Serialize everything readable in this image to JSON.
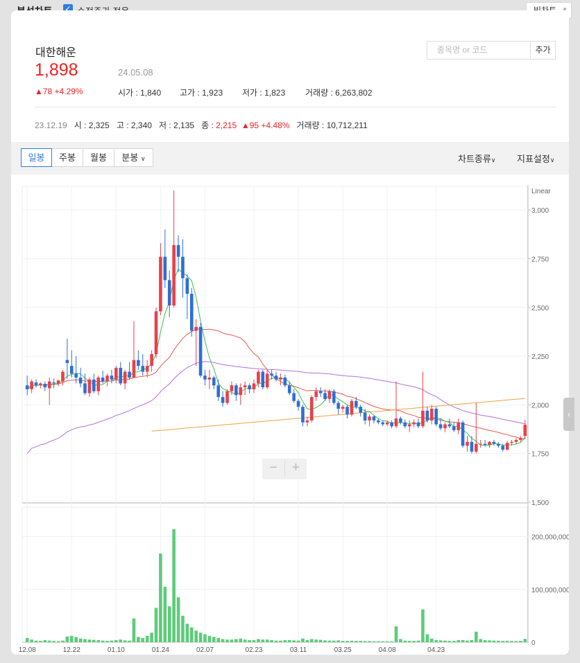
{
  "topbar": {
    "title": "분석차트",
    "checkbox_label": "수정주가 적용",
    "big_chart_label": "빅차트"
  },
  "stock": {
    "name": "대한해운",
    "price": "1,898",
    "date": "24.05.08",
    "change": "▲78 +4.29%",
    "open_label": "시가",
    "open": "1,840",
    "high_label": "고가",
    "high": "1,923",
    "low_label": "저가",
    "low": "1,823",
    "volume_label": "거래량",
    "volume": "6,263,802"
  },
  "search": {
    "placeholder": "종목명 or 코드",
    "add_label": "추가"
  },
  "reference": {
    "date": "23.12.19",
    "open_label": "시",
    "open": "2,325",
    "high_label": "고",
    "high": "2,340",
    "low_label": "저",
    "low": "2,135",
    "close_label": "종",
    "close": "2,215",
    "change": "▲95 +4.48%",
    "volume_label": "거래량",
    "volume": "10,712,211"
  },
  "toolbar": {
    "tabs": [
      "일봉",
      "주봉",
      "월봉",
      "분봉"
    ],
    "active_tab": "일봉",
    "chart_type_label": "차트종류",
    "indicator_label": "지표설정"
  },
  "chart_data": {
    "type": "candlestick",
    "scale_label": "Linear",
    "price_axis": {
      "min": 1500,
      "max": 3100,
      "ticks": [
        "3,000",
        "2,750",
        "2,500",
        "2,250",
        "2,000",
        "1,750",
        "1,500"
      ]
    },
    "volume_axis": {
      "max": 240000000,
      "ticks": [
        "200,000,000",
        "100,000,000",
        "0"
      ]
    },
    "x_ticks": [
      "12.08",
      "12.22",
      "01.10",
      "01.24",
      "02.07",
      "02.23",
      "03.11",
      "03.25",
      "04.08",
      "04.23"
    ],
    "colors": {
      "up": "#e8414a",
      "down": "#2e6fd6",
      "ma5": "#3cc04d",
      "ma20": "#e25a50",
      "ma60": "#b46ee0",
      "ma120": "#f0a040",
      "volume": "#5ecb7a"
    },
    "candles": [
      [
        2100,
        2150,
        2050,
        2080,
        8000000
      ],
      [
        2080,
        2130,
        2060,
        2120,
        5000000
      ],
      [
        2115,
        2130,
        2090,
        2100,
        3000000
      ],
      [
        2100,
        2115,
        2085,
        2110,
        2500000
      ],
      [
        2108,
        2120,
        2070,
        2090,
        4000000
      ],
      [
        2085,
        2140,
        2000,
        2120,
        3000000
      ],
      [
        2115,
        2135,
        2085,
        2110,
        2500000
      ],
      [
        2110,
        2130,
        2095,
        2125,
        2000000
      ],
      [
        2120,
        2180,
        2100,
        2170,
        3000000
      ],
      [
        2230,
        2340,
        2135,
        2215,
        10712211
      ],
      [
        2200,
        2280,
        2140,
        2160,
        12000000
      ],
      [
        2160,
        2250,
        2110,
        2140,
        10000000
      ],
      [
        2140,
        2190,
        2090,
        2110,
        7000000
      ],
      [
        2110,
        2160,
        2050,
        2060,
        6000000
      ],
      [
        2060,
        2140,
        2040,
        2130,
        5000000
      ],
      [
        2130,
        2160,
        2060,
        2070,
        4500000
      ],
      [
        2070,
        2150,
        2050,
        2140,
        4000000
      ],
      [
        2140,
        2175,
        2110,
        2120,
        3000000
      ],
      [
        2120,
        2160,
        2095,
        2150,
        2500000
      ],
      [
        2150,
        2180,
        2110,
        2130,
        3000000
      ],
      [
        2130,
        2200,
        2110,
        2190,
        4000000
      ],
      [
        2190,
        2220,
        2100,
        2110,
        5000000
      ],
      [
        2110,
        2180,
        2080,
        2170,
        3500000
      ],
      [
        2170,
        2220,
        2130,
        2140,
        3000000
      ],
      [
        2140,
        2430,
        2140,
        2230,
        45000000
      ],
      [
        2230,
        2280,
        2180,
        2200,
        10000000
      ],
      [
        2200,
        2260,
        2150,
        2170,
        8000000
      ],
      [
        2170,
        2230,
        2140,
        2200,
        12000000
      ],
      [
        2200,
        2280,
        2170,
        2260,
        18000000
      ],
      [
        2260,
        2500,
        2240,
        2480,
        65000000
      ],
      [
        2480,
        2830,
        2460,
        2760,
        168000000
      ],
      [
        2760,
        2900,
        2600,
        2640,
        105000000
      ],
      [
        2640,
        2690,
        2450,
        2510,
        68000000
      ],
      [
        2510,
        3100,
        2500,
        2820,
        214000000
      ],
      [
        2820,
        2870,
        2680,
        2760,
        85000000
      ],
      [
        2760,
        2850,
        2550,
        2650,
        50000000
      ],
      [
        2650,
        2670,
        2440,
        2570,
        35000000
      ],
      [
        2570,
        2600,
        2350,
        2380,
        28000000
      ],
      [
        2380,
        2440,
        2200,
        2400,
        22000000
      ],
      [
        2400,
        2420,
        2140,
        2150,
        18000000
      ],
      [
        2150,
        2180,
        2100,
        2130,
        15000000
      ],
      [
        2130,
        2180,
        2080,
        2140,
        12000000
      ],
      [
        2140,
        2150,
        2080,
        2100,
        10000000
      ],
      [
        2100,
        2130,
        2020,
        2040,
        8000000
      ],
      [
        2040,
        2070,
        1990,
        2010,
        6000000
      ],
      [
        2010,
        2080,
        2000,
        2070,
        5000000
      ],
      [
        2070,
        2120,
        2050,
        2100,
        5000000
      ],
      [
        2100,
        2110,
        2020,
        2050,
        6000000
      ],
      [
        2050,
        2110,
        2000,
        2090,
        7000000
      ],
      [
        2090,
        2120,
        2050,
        2100,
        5000000
      ],
      [
        2100,
        2110,
        2060,
        2080,
        4000000
      ],
      [
        2080,
        2130,
        2060,
        2110,
        4000000
      ],
      [
        2110,
        2180,
        2090,
        2170,
        6000000
      ],
      [
        2170,
        2180,
        2080,
        2090,
        5000000
      ],
      [
        2090,
        2180,
        2080,
        2160,
        5000000
      ],
      [
        2160,
        2180,
        2130,
        2150,
        4000000
      ],
      [
        2150,
        2170,
        2120,
        2130,
        3000000
      ],
      [
        2130,
        2160,
        2100,
        2140,
        3000000
      ],
      [
        2140,
        2155,
        2090,
        2100,
        4000000
      ],
      [
        2100,
        2120,
        2050,
        2060,
        4000000
      ],
      [
        2060,
        2080,
        2010,
        2020,
        3500000
      ],
      [
        2020,
        2030,
        1970,
        1990,
        3000000
      ],
      [
        1990,
        2000,
        1890,
        1910,
        7000000
      ],
      [
        1910,
        1940,
        1890,
        1920,
        4000000
      ],
      [
        1920,
        2050,
        1910,
        2040,
        6000000
      ],
      [
        2040,
        2090,
        2020,
        2070,
        5000000
      ],
      [
        2070,
        2090,
        2040,
        2060,
        4500000
      ],
      [
        2060,
        2080,
        2020,
        2030,
        3500000
      ],
      [
        2030,
        2080,
        2010,
        2070,
        3000000
      ],
      [
        2070,
        2080,
        2000,
        2010,
        3000000
      ],
      [
        2010,
        2020,
        1950,
        1980,
        3500000
      ],
      [
        1980,
        2000,
        1960,
        1990,
        2500000
      ],
      [
        1990,
        2000,
        1930,
        1950,
        2500000
      ],
      [
        1950,
        2030,
        1940,
        2020,
        2800000
      ],
      [
        2020,
        2040,
        1980,
        1990,
        2500000
      ],
      [
        1990,
        2000,
        1940,
        1960,
        2500000
      ],
      [
        1960,
        1980,
        1900,
        1920,
        2200000
      ],
      [
        1920,
        1950,
        1890,
        1940,
        2000000
      ],
      [
        1940,
        1945,
        1905,
        1920,
        1800000
      ],
      [
        1920,
        1930,
        1900,
        1910,
        1800000
      ],
      [
        1910,
        1920,
        1890,
        1900,
        1600000
      ],
      [
        1900,
        1920,
        1890,
        1910,
        1600000
      ],
      [
        1910,
        1920,
        1880,
        1890,
        1600000
      ],
      [
        1890,
        2120,
        1880,
        1930,
        30000000
      ],
      [
        1930,
        1940,
        1900,
        1910,
        6000000
      ],
      [
        1910,
        1925,
        1880,
        1890,
        3000000
      ],
      [
        1890,
        1920,
        1860,
        1900,
        2500000
      ],
      [
        1900,
        1925,
        1885,
        1910,
        2500000
      ],
      [
        1910,
        1930,
        1880,
        1890,
        3000000
      ],
      [
        1890,
        2170,
        1880,
        1970,
        62000000
      ],
      [
        1970,
        1990,
        1910,
        1920,
        15000000
      ],
      [
        1920,
        2000,
        1900,
        1980,
        7000000
      ],
      [
        1980,
        1990,
        1890,
        1900,
        4000000
      ],
      [
        1900,
        1930,
        1870,
        1880,
        3500000
      ],
      [
        1880,
        1910,
        1860,
        1900,
        3000000
      ],
      [
        1900,
        1930,
        1880,
        1890,
        2500000
      ],
      [
        1890,
        1910,
        1860,
        1870,
        2500000
      ],
      [
        1870,
        1930,
        1850,
        1910,
        4000000
      ],
      [
        1910,
        1920,
        1780,
        1790,
        4000000
      ],
      [
        1790,
        1840,
        1760,
        1810,
        3000000
      ],
      [
        1810,
        1840,
        1750,
        1760,
        4000000
      ],
      [
        1760,
        2010,
        1750,
        1800,
        20000000
      ],
      [
        1800,
        1820,
        1780,
        1800,
        6000000
      ],
      [
        1800,
        1820,
        1785,
        1795,
        4000000
      ],
      [
        1795,
        1815,
        1780,
        1810,
        3500000
      ],
      [
        1810,
        1820,
        1790,
        1800,
        3000000
      ],
      [
        1800,
        1810,
        1780,
        1790,
        2800000
      ],
      [
        1790,
        1800,
        1760,
        1770,
        2500000
      ],
      [
        1770,
        1815,
        1765,
        1805,
        2500000
      ],
      [
        1805,
        1820,
        1790,
        1810,
        2200000
      ],
      [
        1810,
        1830,
        1800,
        1820,
        2200000
      ],
      [
        1820,
        1840,
        1810,
        1830,
        2500000
      ],
      [
        1840,
        1923,
        1823,
        1898,
        6263802
      ]
    ]
  }
}
